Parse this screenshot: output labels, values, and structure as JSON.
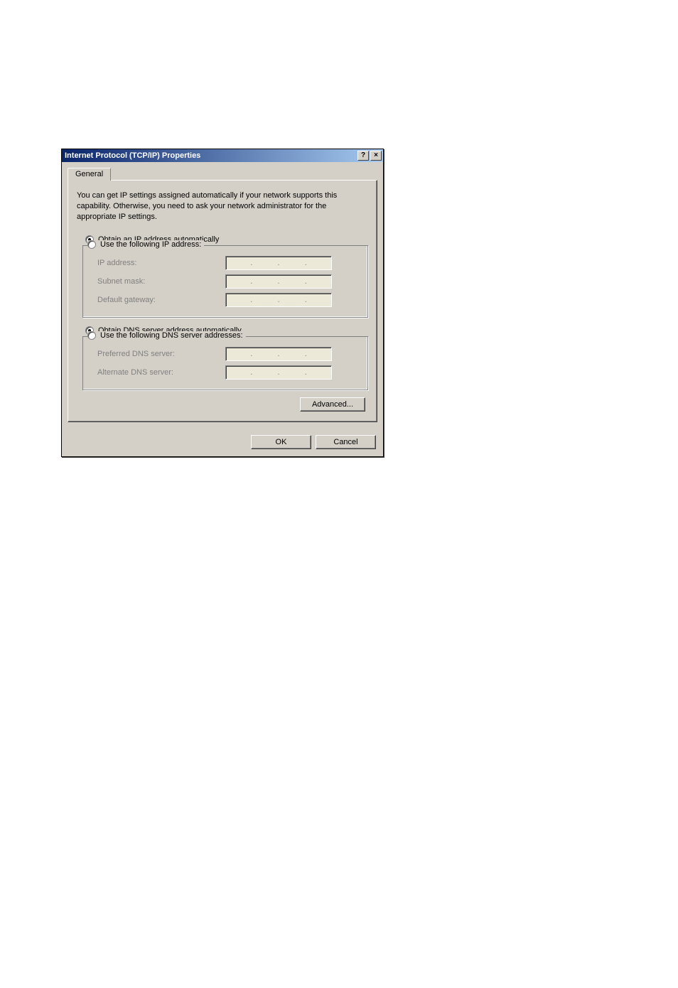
{
  "titlebar": {
    "title": "Internet Protocol (TCP/IP) Properties",
    "help_glyph": "?",
    "close_glyph": "×"
  },
  "tab": {
    "general_label": "General"
  },
  "info_text": "You can get IP settings assigned automatically if your network supports this capability. Otherwise, you need to ask your network administrator for the appropriate IP settings.",
  "ip_section": {
    "obtain_auto_label": "Obtain an IP address automatically",
    "use_following_label": "Use the following IP address:",
    "ip_address_label": "IP address:",
    "subnet_mask_label": "Subnet mask:",
    "default_gateway_label": "Default gateway:",
    "selected": "auto"
  },
  "dns_section": {
    "obtain_auto_label": "Obtain DNS server address automatically",
    "use_following_label": "Use the following DNS server addresses:",
    "preferred_dns_label": "Preferred DNS server:",
    "alternate_dns_label": "Alternate DNS server:",
    "selected": "auto"
  },
  "buttons": {
    "advanced_label": "Advanced...",
    "ok_label": "OK",
    "cancel_label": "Cancel"
  }
}
